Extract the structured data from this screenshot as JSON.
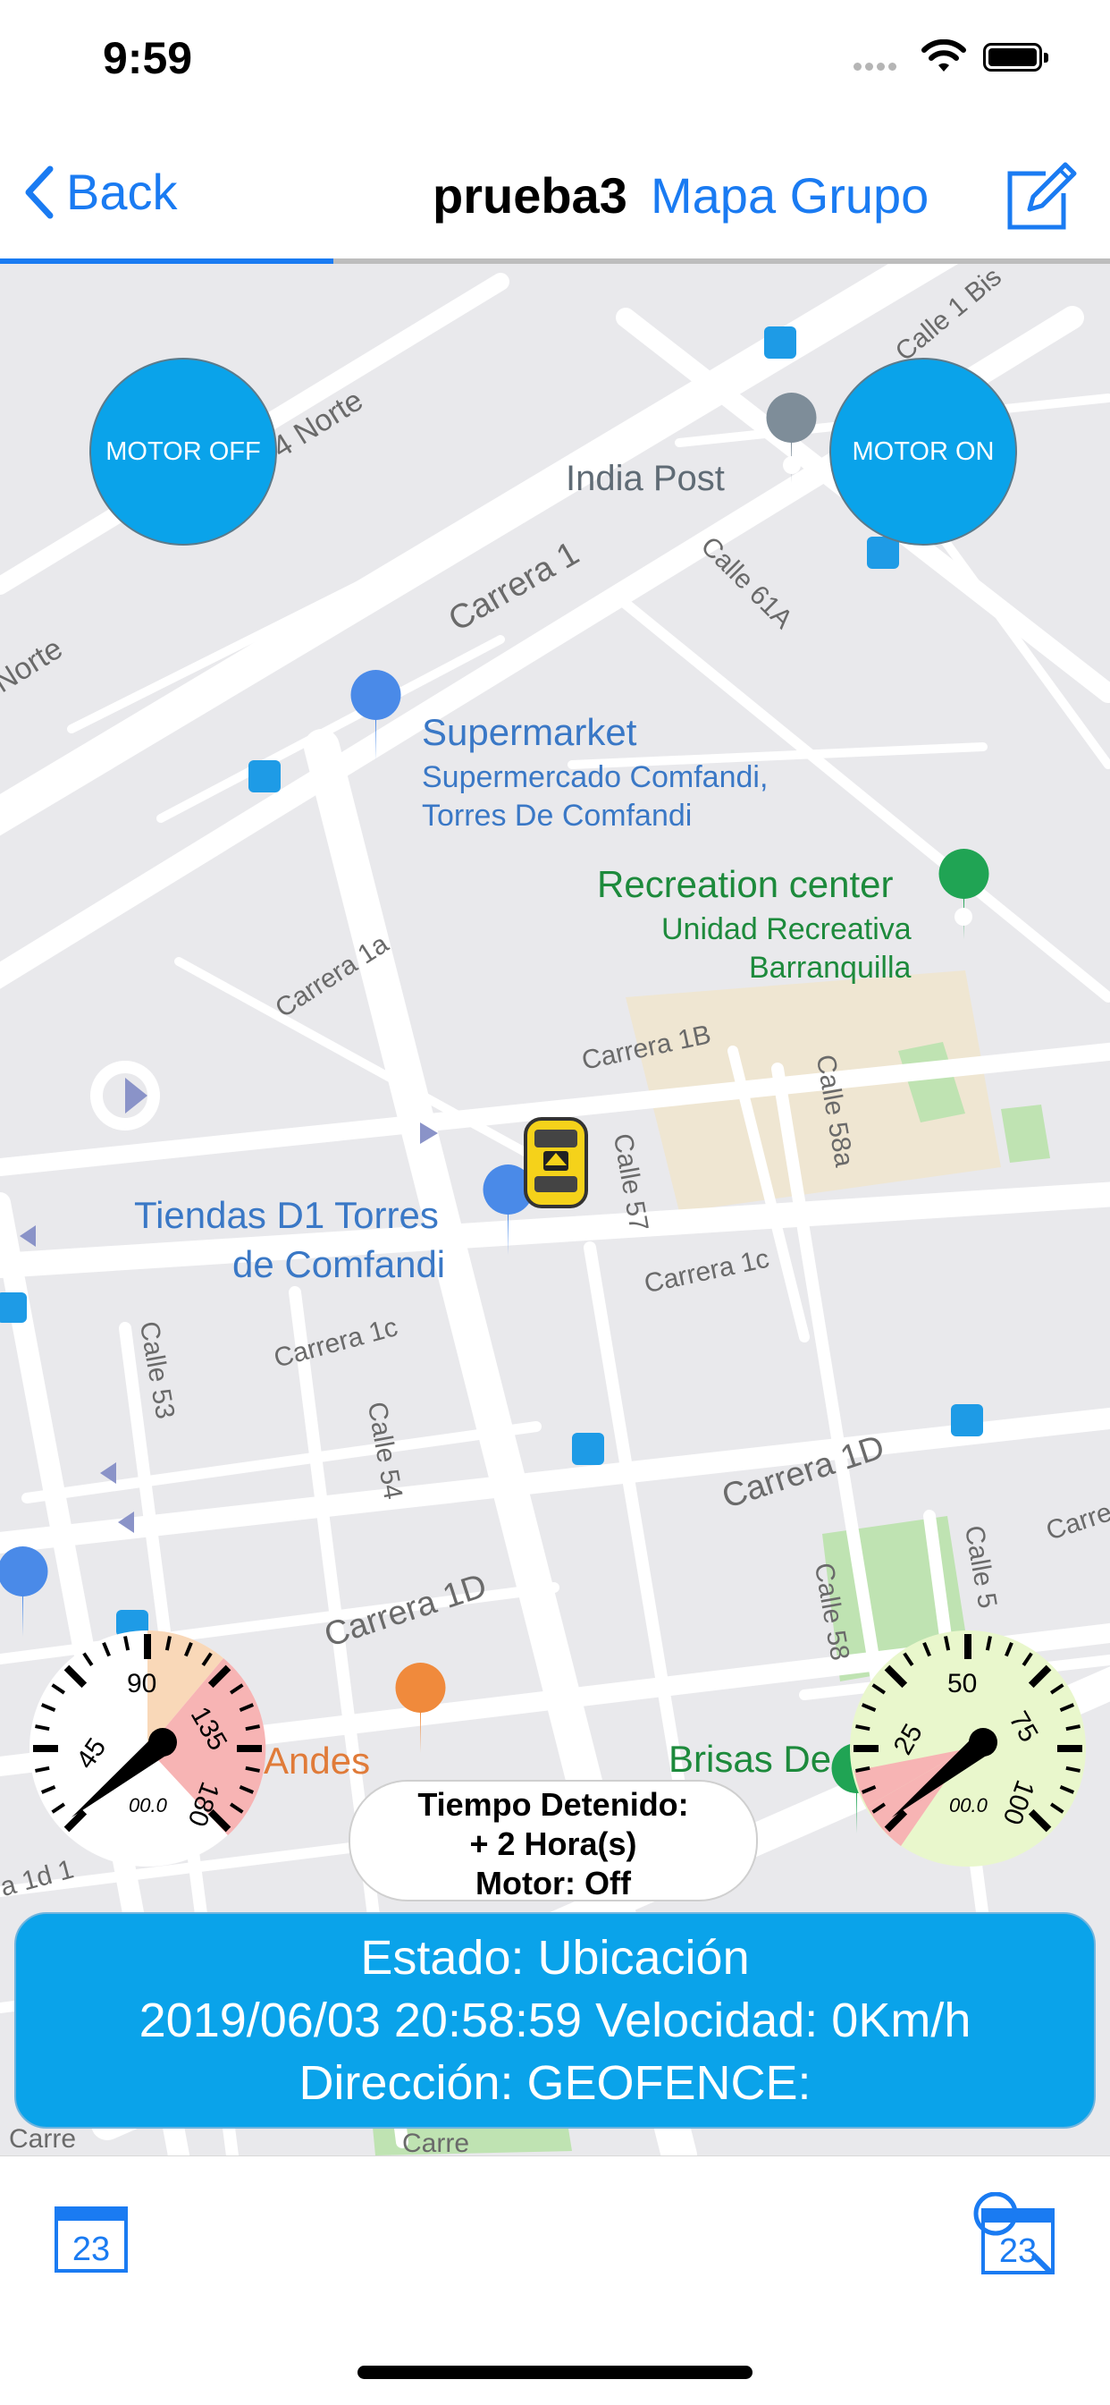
{
  "status_bar": {
    "time": "9:59"
  },
  "nav": {
    "back_label": "Back",
    "title": "prueba3",
    "link_label": "Mapa Grupo",
    "progress": 0.3
  },
  "map": {
    "motor_off_label": "MOTOR OFF",
    "motor_on_label": "MOTOR ON",
    "street_labels": [
      "Norte",
      "4 Norte",
      "Carrera 1",
      "Calle 61A",
      "Calle 1 Bis",
      "Carrera 1a",
      "Carrera 1B",
      "Calle 58a",
      "Calle 57",
      "Carrera 1c",
      "Carrera 1c",
      "Calle 53",
      "Calle 54",
      "Carrera 1D",
      "Carrera 1D",
      "Carre",
      "Calle 58",
      "Calle 5",
      "ra 1d 1",
      "Carre",
      "Carre"
    ],
    "pois": {
      "india_post": "India Post",
      "supermarket_title": "Supermarket",
      "supermarket_line1": "Supermercado Comfandi,",
      "supermarket_line2": "Torres De Comfandi",
      "recreation_title": "Recreation center",
      "recreation_line1": "Unidad Recreativa",
      "recreation_line2": "Barranquilla",
      "tiendas_line1": "Tiendas D1 Torres",
      "tiendas_line2": "de Comfandi",
      "andes": "Andes",
      "brisas": "Brisas De"
    },
    "gauges": {
      "left": {
        "ticks": [
          "45",
          "90",
          "135",
          "180"
        ],
        "readout": "00.0",
        "value": 0
      },
      "right": {
        "ticks": [
          "25",
          "50",
          "75",
          "100"
        ],
        "readout": "00.0",
        "value": 0
      }
    },
    "tiempo": {
      "line1": "Tiempo Detenido:",
      "line2": "+ 2 Hora(s)",
      "line3": "Motor: Off"
    },
    "estado": {
      "line1": "Estado: Ubicación",
      "line2": "2019/06/03 20:58:59 Velocidad: 0Km/h",
      "line3": "Dirección:  GEOFENCE:"
    }
  },
  "toolbar": {
    "left_calendar_day": "23",
    "right_calendar_day": "23"
  },
  "colors": {
    "accent": "#1a7bf2",
    "button_blue": "#0aa3ea",
    "map_bg": "#e9e9ec",
    "park_green": "#bfe3b2"
  }
}
